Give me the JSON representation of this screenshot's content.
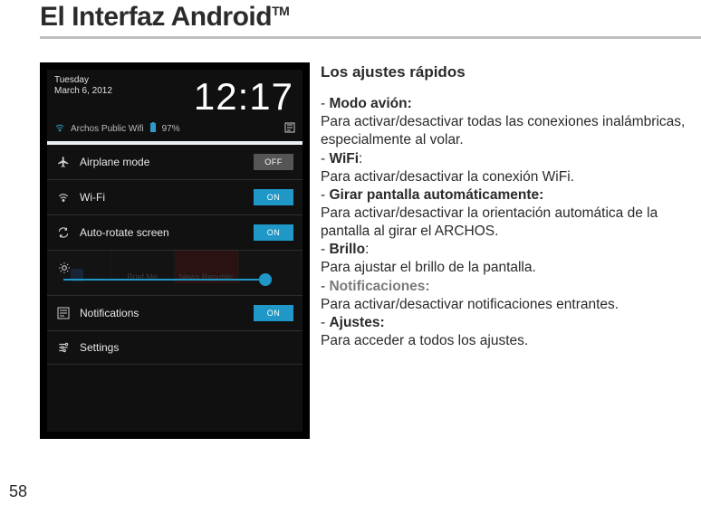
{
  "page": {
    "title": "El Interfaz Android",
    "tm": "TM",
    "number": "58"
  },
  "screenshot": {
    "date_line1": "Tuesday",
    "date_line2": "March 6, 2012",
    "clock": "12:17",
    "wifi_name": "Archos Public Wifi",
    "battery_pct": "97%",
    "rows": {
      "airplane": {
        "label": "Airplane mode",
        "toggle": "OFF"
      },
      "wifi": {
        "label": "Wi-Fi",
        "toggle": "ON"
      },
      "rotate": {
        "label": "Auto-rotate screen",
        "toggle": "ON"
      },
      "notifications": {
        "label": "Notifications",
        "toggle": "ON"
      },
      "settings": {
        "label": "Settings"
      }
    },
    "ghost": {
      "brief": "Brief Me",
      "news": "News Republic"
    }
  },
  "content": {
    "heading": "Los ajustes rápidos",
    "items": {
      "avion_h": "Modo avión:",
      "avion_t": "Para activar/desactivar todas las conexiones inalámbricas, especialmente al volar.",
      "wifi_h": "WiFi",
      "wifi_t": "Para activar/desactivar la conexión WiFi.",
      "rotar_h": "Girar pantalla automáticamente:",
      "rotar_t": "Para activar/desactivar la orientación automática de la pantalla al girar el ARCHOS.",
      "brillo_h": "Brillo",
      "brillo_t": "Para ajustar el brillo de la pantalla.",
      "notif_h": "Notificaciones:",
      "notif_t": "Para activar/desactivar notificaciones entrantes.",
      "ajustes_h": "Ajustes:",
      "ajustes_t": "Para acceder a todos los ajustes."
    }
  }
}
